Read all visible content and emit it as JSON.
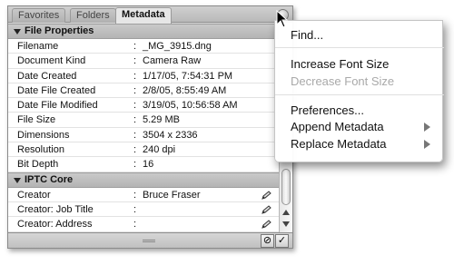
{
  "tabs": [
    {
      "label": "Favorites"
    },
    {
      "label": "Folders"
    },
    {
      "label": "Metadata"
    }
  ],
  "sections": {
    "file_properties": {
      "title": "File Properties",
      "rows": [
        {
          "key": "Filename",
          "value": "_MG_3915.dng"
        },
        {
          "key": "Document Kind",
          "value": "Camera Raw"
        },
        {
          "key": "Date Created",
          "value": "1/17/05, 7:54:31 PM"
        },
        {
          "key": "Date File Created",
          "value": "2/8/05, 8:55:49 AM"
        },
        {
          "key": "Date File Modified",
          "value": "3/19/05, 10:56:58 AM"
        },
        {
          "key": "File Size",
          "value": "5.29 MB"
        },
        {
          "key": "Dimensions",
          "value": "3504 x 2336"
        },
        {
          "key": "Resolution",
          "value": "240 dpi"
        },
        {
          "key": "Bit Depth",
          "value": "16"
        }
      ]
    },
    "iptc_core": {
      "title": "IPTC Core",
      "rows": [
        {
          "key": "Creator",
          "value": "Bruce Fraser"
        },
        {
          "key": "Creator: Job Title",
          "value": ""
        },
        {
          "key": "Creator: Address",
          "value": ""
        }
      ]
    }
  },
  "separator": ":",
  "menu": {
    "items": [
      {
        "label": "Find..."
      },
      {
        "label": "Increase Font Size"
      },
      {
        "label": "Decrease Font Size",
        "disabled": true
      },
      {
        "label": "Preferences..."
      },
      {
        "label": "Append Metadata",
        "submenu": true
      },
      {
        "label": "Replace Metadata",
        "submenu": true
      }
    ]
  },
  "footer": {
    "cancel_symbol": "⊘",
    "apply_symbol": "✓"
  },
  "icons": {
    "close": "close-icon",
    "pencil": "pencil-icon",
    "disclosure": "disclosure-triangle-icon",
    "submenu": "submenu-arrow-icon",
    "cursor": "cursor-icon"
  }
}
